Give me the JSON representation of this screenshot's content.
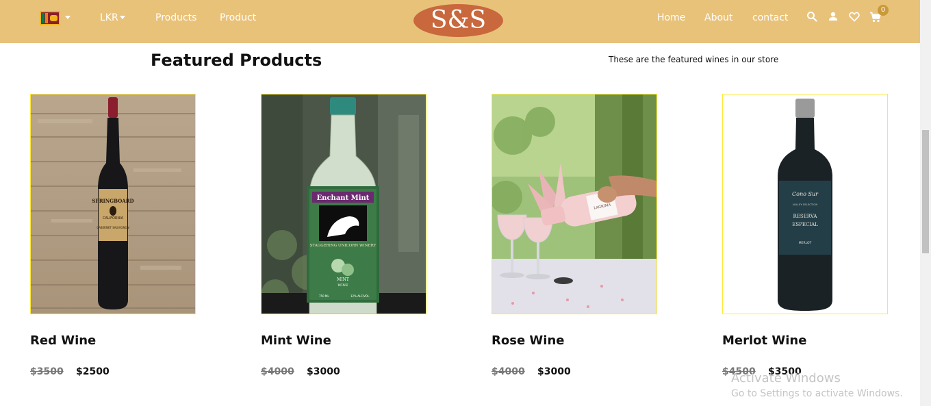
{
  "header": {
    "currency": "LKR",
    "nav_left": [
      "Products",
      "Product"
    ],
    "logo": "S&S",
    "nav_right": [
      "Home",
      "About",
      "contact"
    ],
    "cart_count": "0",
    "icons": [
      "sri-lanka-flag-icon",
      "search-icon",
      "user-icon",
      "heart-icon",
      "cart-icon"
    ]
  },
  "section": {
    "title": "Featured Products",
    "subtitle": "These are the featured wines in our store"
  },
  "products": [
    {
      "name": "Red Wine",
      "old_price": "$3500",
      "price": "$2500"
    },
    {
      "name": "Mint Wine",
      "old_price": "$4000",
      "price": "$3000"
    },
    {
      "name": "Rose Wine",
      "old_price": "$4000",
      "price": "$3000"
    },
    {
      "name": "Merlot Wine",
      "old_price": "$4500",
      "price": "$3500"
    }
  ],
  "labels": {
    "red_brand": "SPRINGBOARD",
    "red_sub": "CALIFORNIA",
    "red_varietal": "CABERNET SAUVIGNON",
    "mint_brand": "Enchant Mint",
    "mint_winery": "STAGGERING UNICORN WINERY",
    "mint_type": "MINT",
    "mint_type2": "WINE",
    "mint_vol": "750 ML",
    "mint_alc": "12% ALC/VOL",
    "rose_brand": "LAGRIMA",
    "merlot_brand": "Cono Sur",
    "merlot_line1": "VALLEY SELECTION",
    "merlot_line2": "RESERVA",
    "merlot_line3": "ESPECIAL",
    "merlot_line4": "MERLOT"
  },
  "watermark": {
    "title": "Activate Windows",
    "subtitle": "Go to Settings to activate Windows."
  },
  "colors": {
    "header_bg": "#e9c27a",
    "logo_bg": "#c9673d",
    "card_border": "#ffe93a"
  }
}
